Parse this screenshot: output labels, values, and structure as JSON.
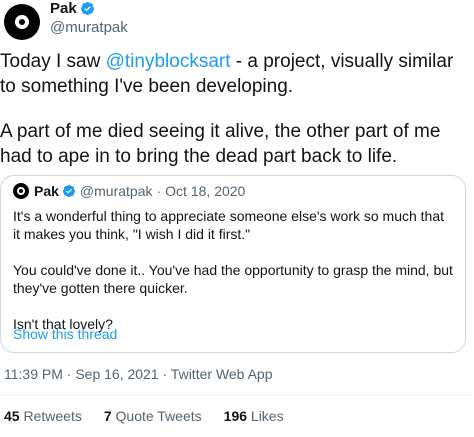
{
  "author": {
    "name": "Pak",
    "handle": "@muratpak"
  },
  "tweet": {
    "text_prefix": "Today I saw ",
    "mention": "@tinyblocksart",
    "text_suffix": " - a project, visually similar to something I've been developing.",
    "paragraph2": "A part of me died seeing it alive, the other part of me had to ape in to bring the dead part back to life."
  },
  "quote": {
    "name": "Pak",
    "handle": "@muratpak",
    "separator": "·",
    "date": "Oct 18, 2020",
    "p1": "It's a wonderful thing to appreciate someone else's work so much that it makes you think, \"I wish I did it first.\"",
    "p2": "You could've done it.. You've had the opportunity to grasp the mind, but they've gotten there quicker.",
    "p3": "Isn't that lovely?",
    "show_thread": "Show this thread"
  },
  "timestamp": "11:39 PM · Sep 16, 2021 · Twitter Web App",
  "stats": {
    "retweets_count": "45",
    "retweets_label": "Retweets",
    "quotes_count": "7",
    "quotes_label": "Quote Tweets",
    "likes_count": "196",
    "likes_label": "Likes"
  },
  "colors": {
    "accent": "#1d9bf0",
    "muted": "#536471",
    "border": "#cfd9de"
  },
  "icons": {
    "verified": "verified-badge-icon",
    "avatar": "avatar"
  }
}
